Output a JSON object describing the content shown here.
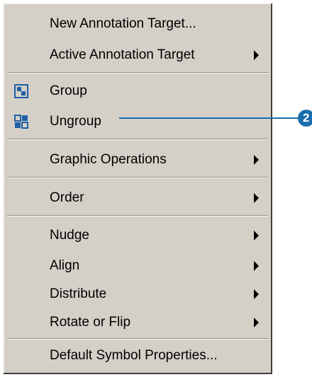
{
  "menu": {
    "items": [
      {
        "label": "New Annotation Target..."
      },
      {
        "label": "Active Annotation Target",
        "submenu": true
      },
      {
        "label": "Group",
        "icon": "group-icon"
      },
      {
        "label": "Ungroup",
        "icon": "ungroup-icon"
      },
      {
        "label": "Graphic Operations",
        "submenu": true
      },
      {
        "label": "Order",
        "submenu": true
      },
      {
        "label": "Nudge",
        "submenu": true
      },
      {
        "label": "Align",
        "submenu": true
      },
      {
        "label": "Distribute",
        "submenu": true
      },
      {
        "label": "Rotate or Flip",
        "submenu": true
      },
      {
        "label": "Default Symbol Properties..."
      }
    ]
  },
  "callout": {
    "number": "2",
    "color": "#1a6fae"
  },
  "colors": {
    "menu_bg": "#d4d0c8",
    "icon_blue": "#1f5fa8"
  }
}
